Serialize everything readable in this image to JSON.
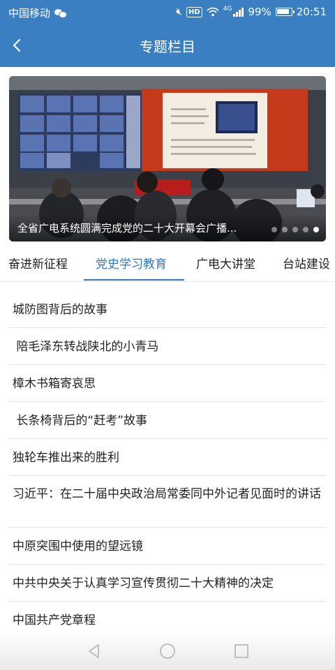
{
  "status_bar": {
    "carrier": "中国移动",
    "hd": "HD",
    "network": "4G",
    "battery_percent": "99%",
    "time": "20:51"
  },
  "header": {
    "title": "专题栏目",
    "back_icon": "chevron-left-icon"
  },
  "banner": {
    "caption": "全省广电系统圆满完成党的二十大开幕会广播...",
    "slide_count": 5,
    "active_slide": 5
  },
  "tabs": [
    {
      "label": "奋进新征程",
      "active": false
    },
    {
      "label": "党史学习教育",
      "active": true
    },
    {
      "label": "广电大讲堂",
      "active": false
    },
    {
      "label": "台站建设",
      "active": false
    }
  ],
  "articles": [
    {
      "title": "城防图背后的故事"
    },
    {
      "title": " 陪毛泽东转战陕北的小青马"
    },
    {
      "title": "樟木书箱寄哀思"
    },
    {
      "title": " 长条椅背后的“赶考”故事"
    },
    {
      "title": "独轮车推出来的胜利"
    },
    {
      "title": "习近平：在二十届中央政治局常委同中外记者见面时的讲话"
    },
    {
      "title": "中原突围中使用的望远镜"
    },
    {
      "title": "中共中央关于认真学习宣传贯彻二十大精神的决定"
    },
    {
      "title": "中国共产党章程"
    }
  ],
  "nav_bar": {
    "back": "triangle-back-icon",
    "home": "circle-home-icon",
    "recents": "square-recents-icon"
  },
  "colors": {
    "brand_blue": "#3a7fc1",
    "tab_active": "#2c78c6"
  }
}
